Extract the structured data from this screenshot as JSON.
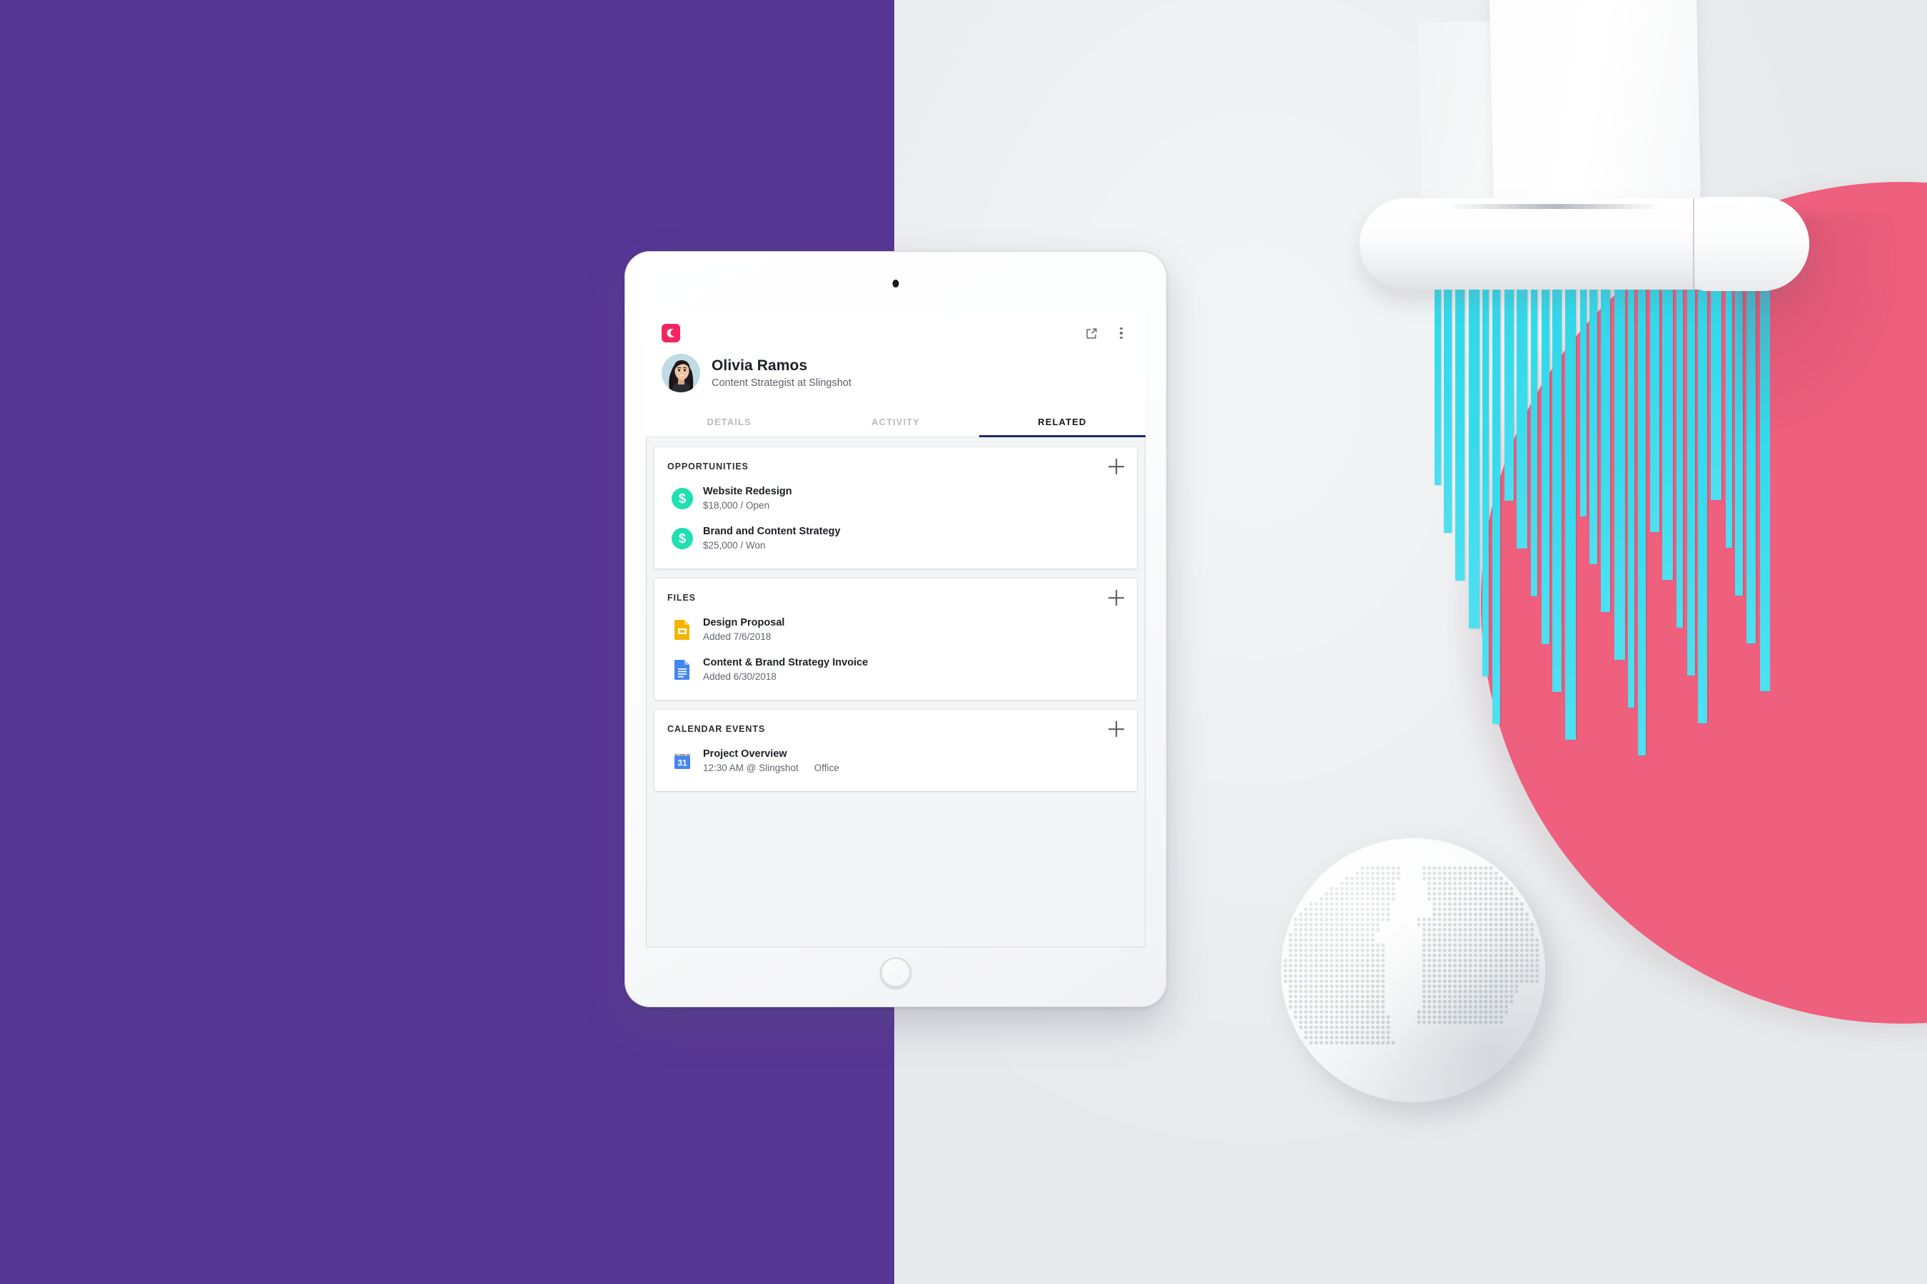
{
  "scene": {
    "colors": {
      "purple_panel": "#563694",
      "gray_panel": "#e7eaec",
      "pink_circle": "#ef5f7e",
      "shredded_paper": "#35dcee",
      "brand_pink": "#f4255f",
      "accent_green": "#1ee0b0",
      "active_tab_underline": "#1b2a68"
    },
    "props": [
      {
        "name": "paper-shredder",
        "label": "Paper shredder"
      },
      {
        "name": "shredded-strips",
        "label": "Shredded cyan paper strips"
      },
      {
        "name": "dotted-globe",
        "label": "Dotted world globe"
      }
    ]
  },
  "device": {
    "name": "tablet",
    "camera_label": "Front camera",
    "home_button_label": "Home"
  },
  "app": {
    "logo_icon": "copper-crm-logo-icon",
    "actions": [
      {
        "name": "open-external-button",
        "icon": "external-link-icon",
        "label": "Open in new window"
      },
      {
        "name": "more-options-button",
        "icon": "more-vertical-icon",
        "label": "More options"
      }
    ],
    "person": {
      "avatar_icon": "avatar",
      "name": "Olivia Ramos",
      "subtitle": "Content Strategist at Slingshot"
    },
    "tabs": [
      {
        "label": "DETAILS",
        "active": false
      },
      {
        "label": "ACTIVITY",
        "active": false
      },
      {
        "label": "RELATED",
        "active": true
      }
    ],
    "sections": [
      {
        "key": "opportunities",
        "title": "OPPORTUNITIES",
        "add_label": "+",
        "items": [
          {
            "icon": "dollar-circle-icon",
            "glyph": "$",
            "title": "Website Redesign",
            "meta": [
              "$18,000 / Open"
            ]
          },
          {
            "icon": "dollar-circle-icon",
            "glyph": "$",
            "title": "Brand and Content Strategy",
            "meta": [
              "$25,000 / Won"
            ]
          }
        ]
      },
      {
        "key": "files",
        "title": "FILES",
        "add_label": "+",
        "items": [
          {
            "icon": "google-slides-file-icon",
            "title": "Design Proposal",
            "meta": [
              "Added 7/6/2018"
            ]
          },
          {
            "icon": "google-docs-file-icon",
            "title": "Content & Brand Strategy Invoice",
            "meta": [
              "Added 6/30/2018"
            ]
          }
        ]
      },
      {
        "key": "calendar_events",
        "title": "CALENDAR EVENTS",
        "add_label": "+",
        "items": [
          {
            "icon": "google-calendar-icon",
            "icon_text": "31",
            "title": "Project Overview",
            "meta": [
              "12:30 AM @ Slingshot",
              "Office"
            ]
          }
        ]
      }
    ]
  }
}
